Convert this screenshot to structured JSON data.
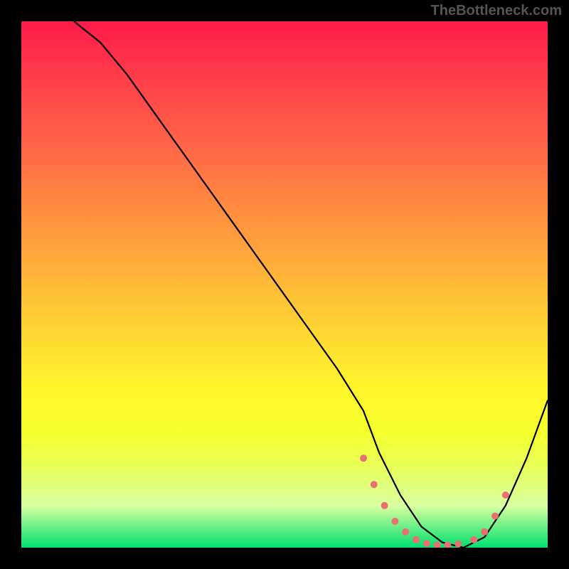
{
  "watermark": "TheBottleneck.com",
  "chart_data": {
    "type": "line",
    "title": "",
    "xlabel": "",
    "ylabel": "",
    "xlim": [
      0,
      100
    ],
    "ylim": [
      0,
      100
    ],
    "series": [
      {
        "name": "curve",
        "x": [
          10,
          15,
          20,
          25,
          30,
          35,
          40,
          45,
          50,
          55,
          60,
          65,
          68,
          72,
          76,
          80,
          84,
          88,
          92,
          96,
          100
        ],
        "y": [
          100,
          96,
          90,
          83,
          76,
          69,
          62,
          55,
          48,
          41,
          34,
          26,
          18,
          10,
          4,
          1,
          0,
          2,
          8,
          17,
          28
        ]
      }
    ],
    "markers": {
      "x": [
        65,
        67,
        69,
        71,
        73,
        75,
        77,
        79,
        81,
        83,
        86,
        88,
        90,
        92
      ],
      "y": [
        17,
        12,
        8,
        5,
        3,
        1.5,
        0.8,
        0.5,
        0.5,
        0.7,
        1.5,
        3,
        6,
        10
      ]
    },
    "gradient_stops": [
      {
        "pos": 0.0,
        "color": "#ff1a4a"
      },
      {
        "pos": 0.5,
        "color": "#ffba38"
      },
      {
        "pos": 0.78,
        "color": "#f5ff2c"
      },
      {
        "pos": 1.0,
        "color": "#00e070"
      }
    ]
  }
}
